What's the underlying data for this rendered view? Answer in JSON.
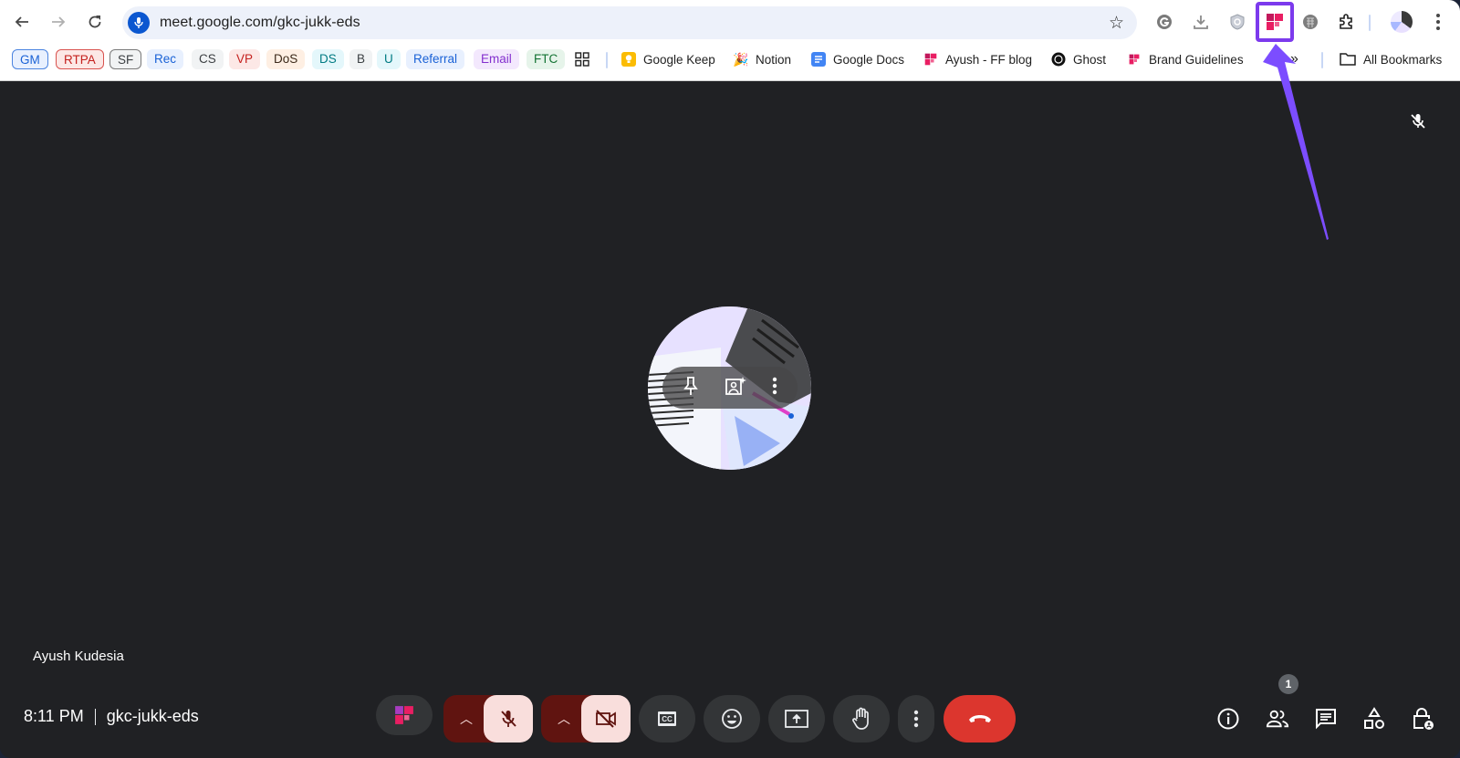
{
  "browser": {
    "url": "meet.google.com/gkc-jukk-eds",
    "nav": {
      "back": "back-icon",
      "forward": "forward-icon",
      "reload": "reload-icon"
    },
    "toolbar_icons": [
      "grammarly-icon",
      "download-icon",
      "shield-extension-icon",
      "fireflies-extension-icon",
      "elephant-extension-icon",
      "extensions-icon",
      "profile-avatar",
      "menu-icon"
    ]
  },
  "bookmarks": {
    "chips": [
      {
        "label": "GM",
        "bg": "#e8f0fe",
        "fg": "#1a62d6",
        "border": "#4b84e0"
      },
      {
        "label": "RTPA",
        "bg": "#fce8e6",
        "fg": "#c5221f",
        "border": "#d9534f"
      },
      {
        "label": "SF",
        "bg": "#f1f3f4",
        "fg": "#3c4043",
        "border": "#7a7a7a"
      },
      {
        "label": "Rec",
        "bg": "#e8f0fe",
        "fg": "#1a62d6",
        "border": ""
      },
      {
        "label": "CS",
        "bg": "#f1f3f4",
        "fg": "#3c4043",
        "border": ""
      },
      {
        "label": "VP",
        "bg": "#fce8e6",
        "fg": "#c5221f",
        "border": ""
      },
      {
        "label": "DoS",
        "bg": "#feefe3",
        "fg": "#3c2a1a",
        "border": ""
      },
      {
        "label": "DS",
        "bg": "#e4f7fb",
        "fg": "#007b83",
        "border": ""
      },
      {
        "label": "B",
        "bg": "#f1f3f4",
        "fg": "#3c4043",
        "border": ""
      },
      {
        "label": "U",
        "bg": "#e4f7fb",
        "fg": "#007b83",
        "border": ""
      },
      {
        "label": "Referral",
        "bg": "#e8f0fe",
        "fg": "#1a62d6",
        "border": ""
      },
      {
        "label": "Email",
        "bg": "#f3e8fd",
        "fg": "#8430ce",
        "border": ""
      },
      {
        "label": "FTC",
        "bg": "#e6f4ea",
        "fg": "#137333",
        "border": ""
      }
    ],
    "links": [
      {
        "label": "Google Keep",
        "icon": "google-keep-icon"
      },
      {
        "label": "Notion",
        "icon": "party-popper-icon"
      },
      {
        "label": "Google Docs",
        "icon": "google-docs-icon"
      },
      {
        "label": "Ayush - FF blog",
        "icon": "fireflies-icon"
      },
      {
        "label": "Ghost",
        "icon": "ghost-icon"
      },
      {
        "label": "Brand Guidelines",
        "icon": "fireflies-icon"
      }
    ],
    "overflow": "»",
    "all_bookmarks": "All Bookmarks"
  },
  "meet": {
    "participant_name": "Ayush Kudesia",
    "time": "8:11 PM",
    "meeting_code": "gkc-jukk-eds",
    "participant_count": "1",
    "controls": [
      "fireflies",
      "mic-options",
      "mic-off",
      "camera-options",
      "camera-off",
      "captions",
      "reactions",
      "present",
      "raise-hand",
      "more-options",
      "leave-call"
    ],
    "right_controls": [
      "meeting-details",
      "people",
      "chat",
      "activities",
      "host-controls"
    ]
  },
  "colors": {
    "annotation": "#7c3aed",
    "end_call": "#dc362e",
    "muted_bg": "#f9dedc",
    "muted_dark": "#601410"
  }
}
